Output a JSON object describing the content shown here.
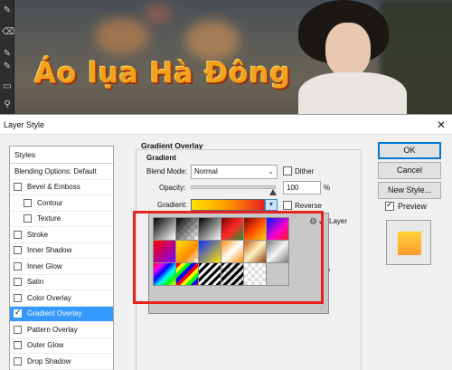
{
  "banner_text": "Áo lụa Hà Đông",
  "toolbar": {
    "icons": [
      "brush-icon",
      "eraser-icon",
      "brush-icon",
      "brush-icon",
      "rectangle-icon",
      "zoom-icon",
      "hand-icon",
      "dodge-icon"
    ]
  },
  "dialog": {
    "title": "Layer Style",
    "close": "✕",
    "styles_header": "Styles",
    "blending": "Blending Options: Default",
    "styles": [
      {
        "label": "Bevel & Emboss",
        "checked": false,
        "sub": false,
        "selected": false
      },
      {
        "label": "Contour",
        "checked": false,
        "sub": true,
        "selected": false
      },
      {
        "label": "Texture",
        "checked": false,
        "sub": true,
        "selected": false
      },
      {
        "label": "Stroke",
        "checked": false,
        "sub": false,
        "selected": false
      },
      {
        "label": "Inner Shadow",
        "checked": false,
        "sub": false,
        "selected": false
      },
      {
        "label": "Inner Glow",
        "checked": false,
        "sub": false,
        "selected": false
      },
      {
        "label": "Satin",
        "checked": false,
        "sub": false,
        "selected": false
      },
      {
        "label": "Color Overlay",
        "checked": false,
        "sub": false,
        "selected": false
      },
      {
        "label": "Gradient Overlay",
        "checked": true,
        "sub": false,
        "selected": true
      },
      {
        "label": "Pattern Overlay",
        "checked": false,
        "sub": false,
        "selected": false
      },
      {
        "label": "Outer Glow",
        "checked": false,
        "sub": false,
        "selected": false
      },
      {
        "label": "Drop Shadow",
        "checked": false,
        "sub": false,
        "selected": false
      }
    ],
    "gradient_overlay": {
      "group_title": "Gradient Overlay",
      "sub_title": "Gradient",
      "blend_mode_label": "Blend Mode:",
      "blend_mode_value": "Normal",
      "dither_label": "Dither",
      "dither_checked": false,
      "opacity_label": "Opacity:",
      "opacity_value": "100",
      "opacity_unit": "%",
      "opacity_level": 1.0,
      "gradient_label": "Gradient:",
      "reverse_label": "Reverse",
      "reverse_checked": false,
      "layer_label": "Layer",
      "percent2": "%"
    },
    "picker": {
      "swatches": [
        "linear-gradient(135deg,#000 0%,#fff 100%)",
        "linear-gradient(135deg,#000 0%,rgba(0,0,0,0) 100%),repeating-conic-gradient(#ddd 0 25%,#fff 0 50%) 0 0/8px 8px",
        "linear-gradient(135deg,#000 0%,#fff 100%)",
        "linear-gradient(135deg,#7a0000 0%,#ff2a2a 50%,#2a8f2a 100%)",
        "linear-gradient(135deg,#7a0000 0%,#ff4c00 50%,#ffd200 100%)",
        "linear-gradient(135deg,#0018ff 0%,#ff00c8 60%,#ff1a1a 100%)",
        "linear-gradient(135deg,#ff0000 0%,#7a00ff 100%)",
        "linear-gradient(135deg,#ffe600 0%,#ff8a00 60%,rgba(255,255,255,0) 100%),repeating-conic-gradient(#ddd 0 25%,#fff 0 50%) 0 0/8px 8px",
        "linear-gradient(135deg,#0a2bff 0%,#ffe500 100%)",
        "linear-gradient(135deg,#ff8a00 0%,#ffffff 50%,#ff8a00 100%)",
        "linear-gradient(135deg,#c05a0c 0%,#fff3c4 50%,#8c3d06 100%)",
        "linear-gradient(135deg,#7a7a7a 0%,#f5f5f5 50%,#7a7a7a 100%)",
        "linear-gradient(135deg,#ff0000 0%,#ff00ff 20%,#0000ff 40%,#00ffff 60%,#00ff00 80%,#ffff00 100%)",
        "repeating-linear-gradient(135deg,#ff0000 0 4px,#ffff00 4px 8px,#00ff00 8px 12px,#0000ff 12px 16px),repeating-conic-gradient(#ddd 0 25%,#fff 0 50%) 0 0/8px 8px",
        "repeating-linear-gradient(135deg,#000 0 3px,#fff 3px 6px)",
        "repeating-linear-gradient(135deg,#000 0 3px,rgba(255,255,255,0) 3px 6px),repeating-conic-gradient(#ddd 0 25%,#fff 0 50%) 0 0/8px 8px",
        "repeating-conic-gradient(#ddd 0 25%,#fff 0 50%) 0 0/8px 8px",
        "empty"
      ]
    },
    "buttons": {
      "ok": "OK",
      "cancel": "Cancel",
      "new_style": "New Style...",
      "preview": "Preview",
      "preview_checked": true
    },
    "colors": {
      "selection": "#3399ff",
      "highlight": "#e52421"
    }
  }
}
